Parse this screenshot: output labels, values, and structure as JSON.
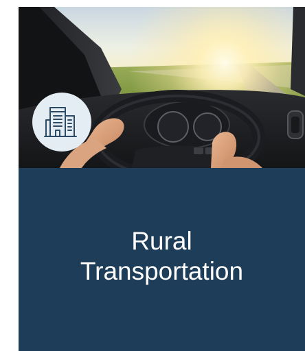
{
  "card": {
    "icon": "office-building-icon",
    "title_lines": [
      "Rural",
      "Transportation"
    ]
  },
  "colors": {
    "panel": "#1e3d59",
    "badge": "#e4edf4",
    "icon_stroke": "#2c4a63",
    "text": "#ffffff"
  },
  "photo": {
    "subject": "driver-hands-on-steering-wheel"
  }
}
